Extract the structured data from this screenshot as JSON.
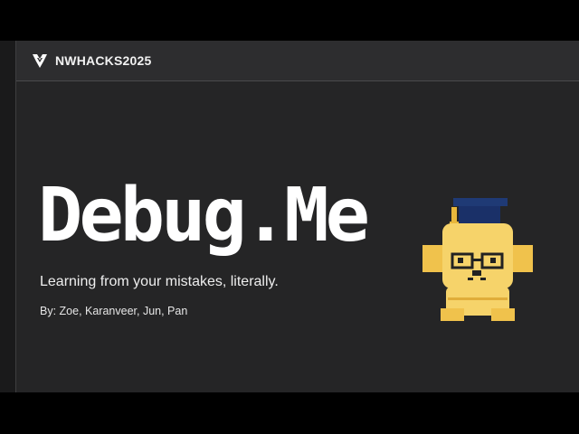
{
  "header": {
    "brand": "NWHACKS2025",
    "logo_icon": "nwhacks-logo-icon"
  },
  "hero": {
    "title": "Debug.Me",
    "subtitle": "Learning from your mistakes, literally.",
    "byline": "By: Zoe, Karanveer, Jun, Pan"
  },
  "mascot": {
    "icon": "pixel-dog-graduation-cap-icon"
  },
  "colors": {
    "background": "#252526",
    "header_background": "#2d2d2f",
    "text": "#ffffff",
    "mascot_fur": "#f6d36a",
    "mascot_cap": "#1f3a75"
  }
}
